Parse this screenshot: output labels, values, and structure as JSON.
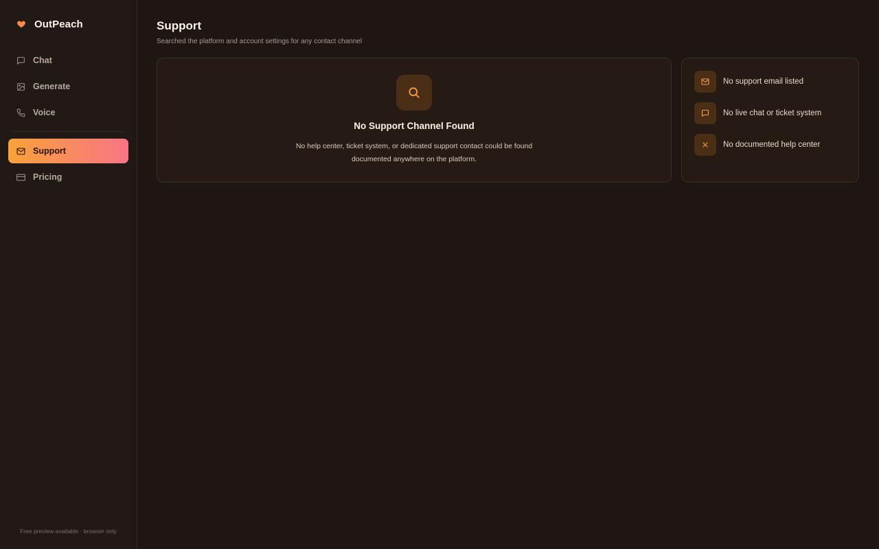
{
  "brand": {
    "name": "OutPeach",
    "icon": "heart-icon",
    "accent": "#f7894a"
  },
  "nav": {
    "items": [
      {
        "label": "Chat",
        "icon": "chat-bubble-icon"
      },
      {
        "label": "Generate",
        "icon": "image-icon"
      },
      {
        "label": "Voice",
        "icon": "phone-icon"
      },
      {
        "label": "Support",
        "icon": "mail-icon",
        "active": true
      },
      {
        "label": "Pricing",
        "icon": "credit-card-icon"
      }
    ],
    "active_gradient": [
      "#f7a23a",
      "#f97584"
    ]
  },
  "footer": {
    "text": "Free preview available · browser only"
  },
  "page": {
    "title": "Support",
    "subtitle": "Searched the platform and account settings for any contact channel"
  },
  "empty_state": {
    "icon": "search-icon",
    "title": "No Support Channel Found",
    "description": "No help center, ticket system, or dedicated support contact could be found documented anywhere on the platform."
  },
  "findings": [
    {
      "icon": "mail-icon",
      "text": "No support email listed"
    },
    {
      "icon": "chat-bubble-icon",
      "text": "No live chat or ticket system"
    },
    {
      "icon": "x-icon",
      "text": "No documented help center"
    }
  ]
}
